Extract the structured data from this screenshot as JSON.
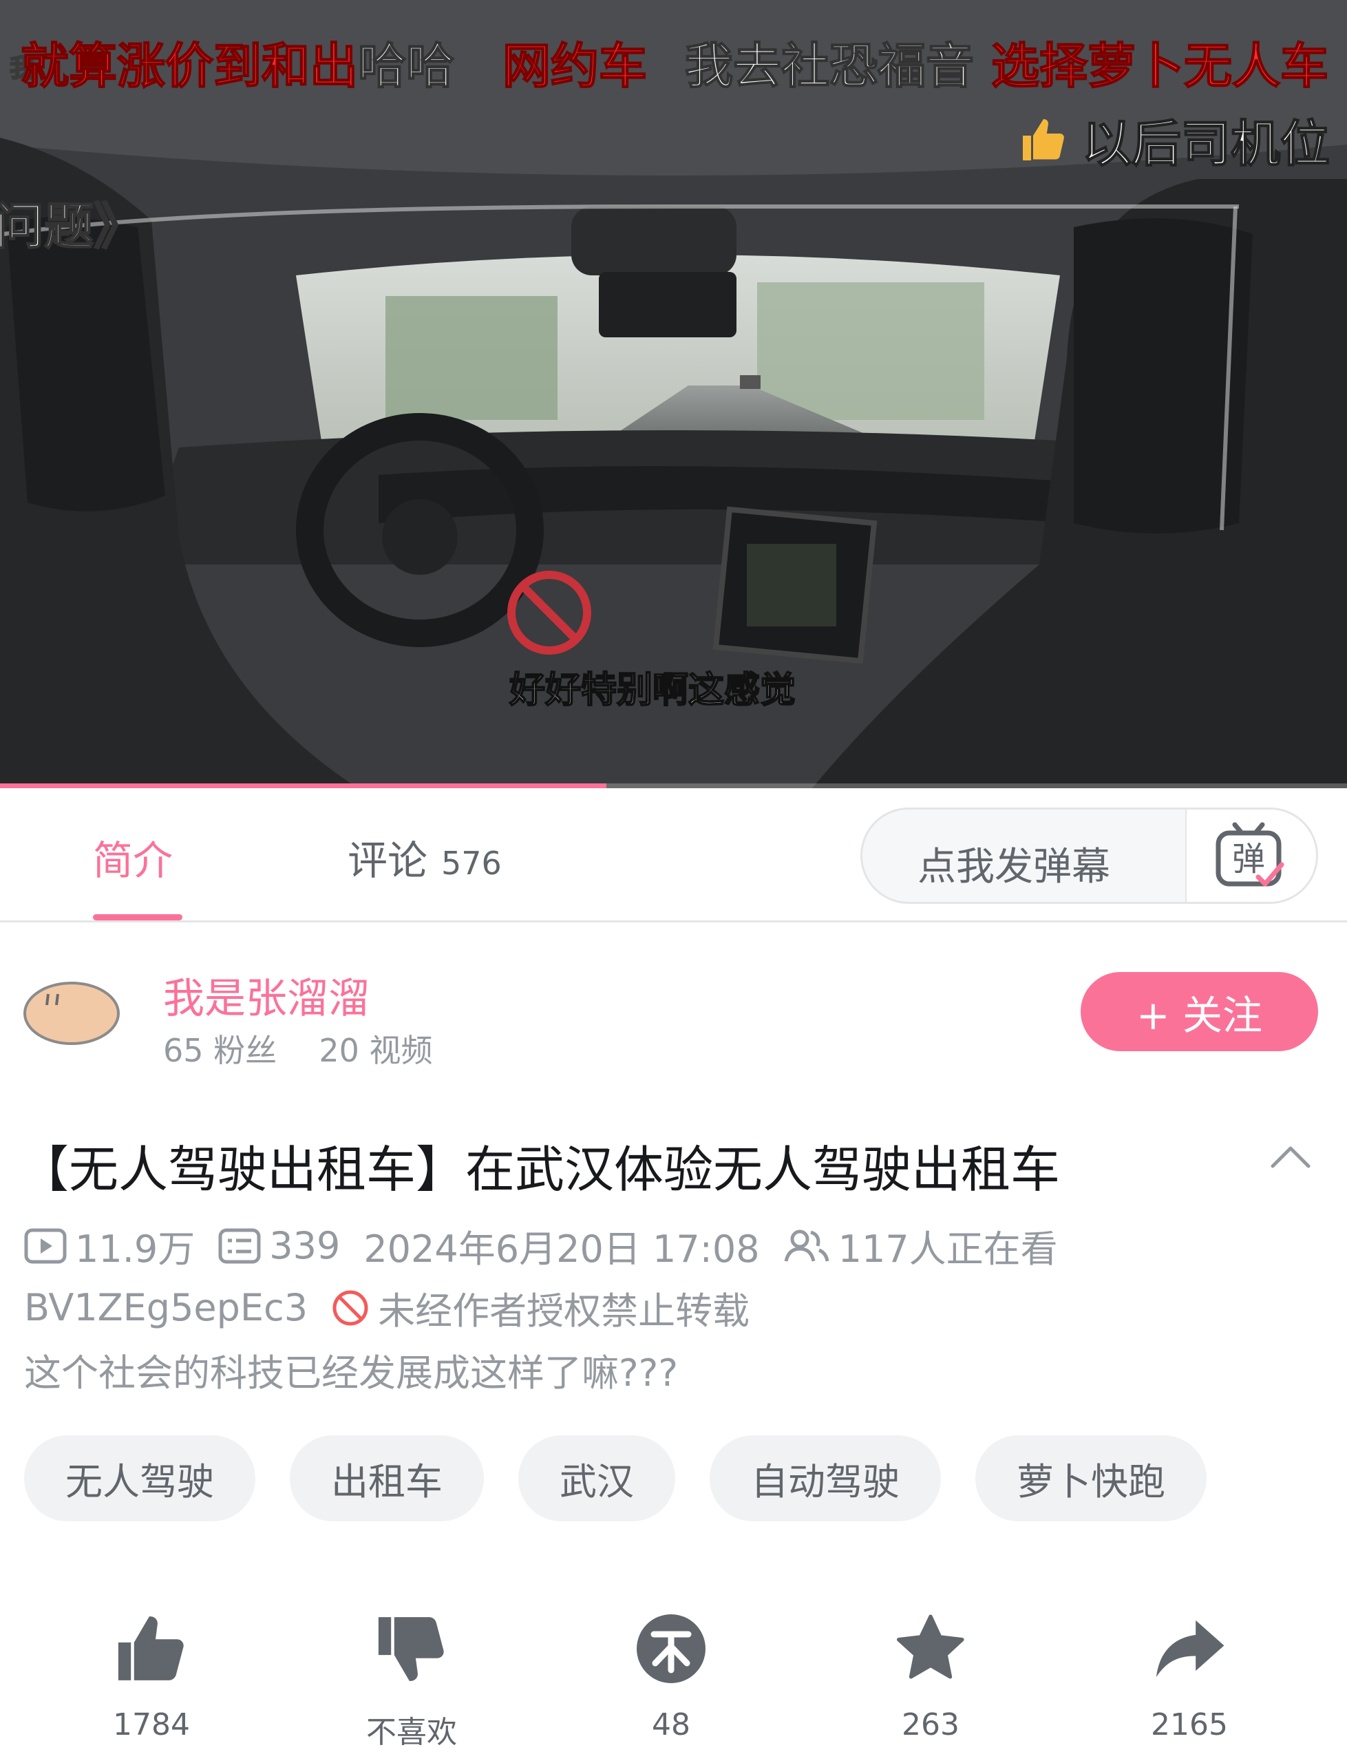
{
  "colors": {
    "accent": "#fb7299",
    "text_primary": "#18191c",
    "text_secondary": "#61666d",
    "text_muted": "#9499a0",
    "tag_bg": "#f1f2f3",
    "danmaku_red": "#ff2a2a"
  },
  "video": {
    "danmaku": {
      "line1_part1": "就算涨价到和出",
      "line1_part2": "哈哈",
      "line1_part3": "网约车",
      "line1_part4": "我去社恐福音",
      "line1_part5": "选择萝卜无人车",
      "line1_faded": "我",
      "line2_like": "以后司机位",
      "left_fragment": "问题》"
    },
    "subtitle": "好好特别啊这感觉",
    "progress_fraction": 0.45
  },
  "tabs": {
    "intro_label": "简介",
    "comments_label": "评论",
    "comments_count": "576",
    "danmaku_placeholder": "点我发弹幕",
    "danmaku_button_glyph": "弹"
  },
  "uploader": {
    "name": "我是张溜溜",
    "fans": "65 粉丝",
    "videos": "20 视频",
    "follow_label": "+ 关注"
  },
  "video_info": {
    "title": "【无人驾驶出租车】在武汉体验无人驾驶出租车",
    "views": "11.9万",
    "danmaku_count": "339",
    "date": "2024年6月20日 17:08",
    "watching": "117人正在看",
    "bvid": "BV1ZEg5epEc3",
    "reprint_notice": "未经作者授权禁止转载",
    "description": "这个社会的科技已经发展成这样了嘛???"
  },
  "tags": [
    "无人驾驶",
    "出租车",
    "武汉",
    "自动驾驶",
    "萝卜快跑"
  ],
  "actions": {
    "like": {
      "icon": "thumbs-up-icon",
      "count": "1784"
    },
    "dislike": {
      "icon": "thumbs-down-icon",
      "label": "不喜欢"
    },
    "coin": {
      "icon": "coin-icon",
      "count": "48"
    },
    "favorite": {
      "icon": "star-icon",
      "count": "263"
    },
    "share": {
      "icon": "share-icon",
      "count": "2165"
    }
  }
}
